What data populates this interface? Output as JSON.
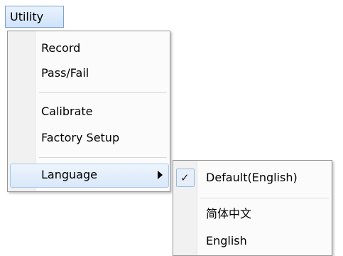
{
  "menubar": {
    "utility_label": "Utility"
  },
  "utility_menu": {
    "items": [
      "Record",
      "Pass/Fail",
      "Calibrate",
      "Factory Setup",
      "Language"
    ]
  },
  "language_submenu": {
    "check_mark": "✓",
    "items": [
      "Default(English)",
      "简体中文",
      "English"
    ]
  }
}
